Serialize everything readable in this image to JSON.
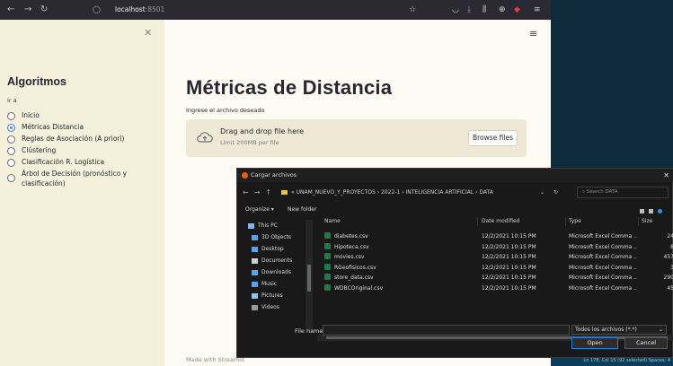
{
  "browser": {
    "url_host": "localhost",
    "url_port": ":8501"
  },
  "sidebar": {
    "title": "Algoritmos",
    "nav_label": "Ir a",
    "items": [
      {
        "label": "Inicio",
        "selected": false
      },
      {
        "label": "Métricas Distancia",
        "selected": true
      },
      {
        "label": "Reglas de Asociación (A priori)",
        "selected": false
      },
      {
        "label": "Clústering",
        "selected": false
      },
      {
        "label": "Clasificación R. Logística",
        "selected": false
      },
      {
        "label": "Árbol de Decisión (pronóstico y",
        "label2": "clasificación)",
        "selected": false
      }
    ]
  },
  "main": {
    "title": "Métricas de Distancia",
    "upload_label": "Ingrese el archivo deseado",
    "drop_text": "Drag and drop file here",
    "limit_text": "Limit 200MB per file",
    "browse_label": "Browse files",
    "footer": "Made with Streamlit"
  },
  "dialog": {
    "title": "Cargar archivos",
    "path": [
      "UNAM_NUEVO_Y_PROYECTOS",
      "2022-1",
      "INTELIGENCIA ARTIFICIAL",
      "DATA"
    ],
    "search_placeholder": "Search DATA",
    "organize": "Organize ▾",
    "new_folder": "New folder",
    "nav_items": [
      "This PC",
      "3D Objects",
      "Desktop",
      "Documents",
      "Downloads",
      "Music",
      "Pictures",
      "Videos"
    ],
    "columns": [
      "Name",
      "Date modified",
      "Type",
      "Size"
    ],
    "files": [
      {
        "name": "diabetes.csv",
        "date": "12/2/2021 10:15 PM",
        "type": "Microsoft Excel Comma ...",
        "size": "24"
      },
      {
        "name": "Hipoteca.csv",
        "date": "12/2/2021 10:15 PM",
        "type": "Microsoft Excel Comma ...",
        "size": "8"
      },
      {
        "name": "movies.csv",
        "date": "12/2/2021 10:15 PM",
        "type": "Microsoft Excel Comma ...",
        "size": "457"
      },
      {
        "name": "RGeofisicos.csv",
        "date": "12/2/2021 10:15 PM",
        "type": "Microsoft Excel Comma ...",
        "size": "3"
      },
      {
        "name": "store_data.csv",
        "date": "12/2/2021 10:15 PM",
        "type": "Microsoft Excel Comma ...",
        "size": "290"
      },
      {
        "name": "WDBCOriginal.csv",
        "date": "12/2/2021 10:15 PM",
        "type": "Microsoft Excel Comma ...",
        "size": "45"
      }
    ],
    "file_name_label": "File name:",
    "file_name_value": "",
    "filter": "Todos los archivos (*.*)",
    "open_label": "Open",
    "cancel_label": "Cancel"
  },
  "editor_status": "Ln 178, Col 15 (92 selected)  Spaces: 4"
}
